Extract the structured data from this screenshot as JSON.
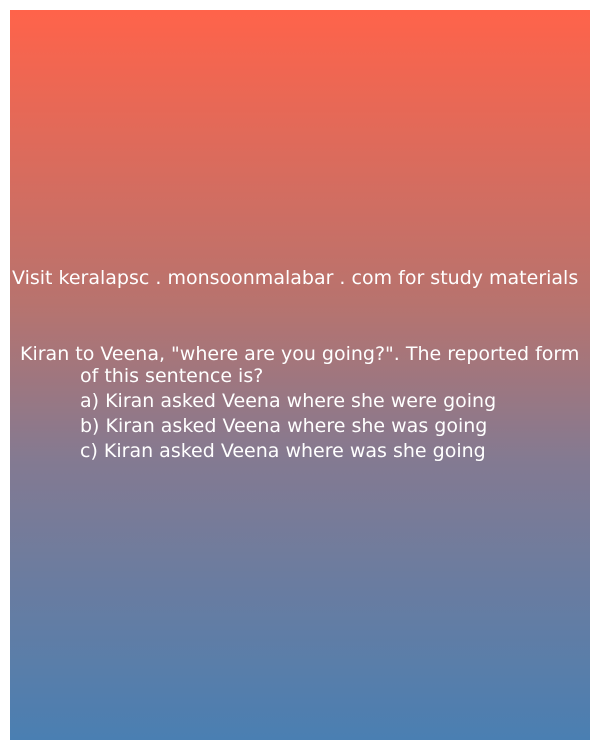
{
  "visit_text": "Visit keralapsc . monsoonmalabar . com for study materials",
  "question": "Kiran to Veena, \"where are you going?\". The reported form of this sentence is?",
  "options": [
    "a) Kiran asked Veena where she were going",
    "b) Kiran asked Veena where she was going",
    "c) Kiran asked Veena where was she going"
  ],
  "colors": {
    "gradient_top": "#ff634a",
    "gradient_bottom": "#4a7fb2",
    "text": "#ffffff"
  }
}
